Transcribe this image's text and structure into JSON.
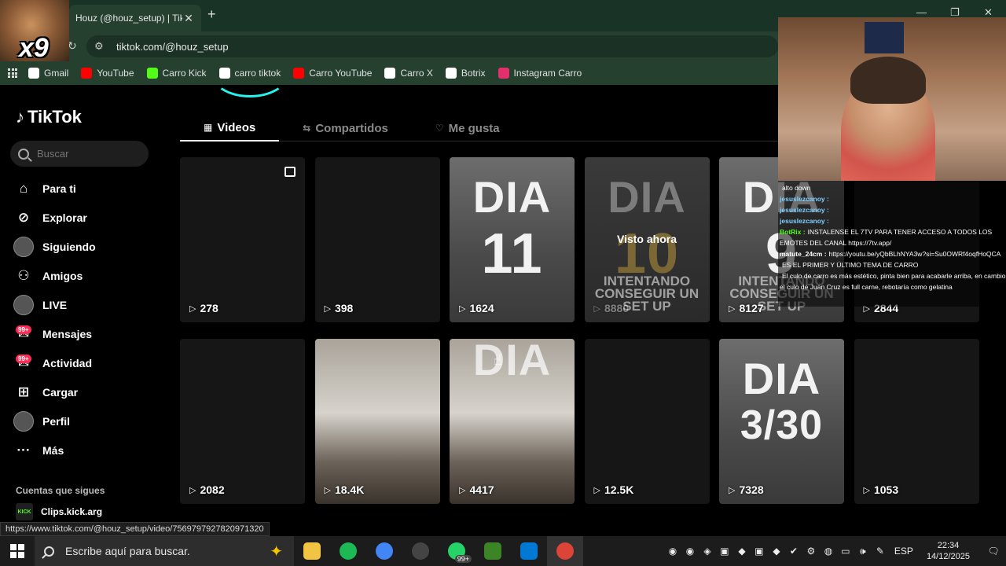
{
  "browser": {
    "tab_title": "Houz (@houz_setup) | TikTok",
    "url": "tiktok.com/@houz_setup",
    "bookmarks": [
      {
        "label": "Gmail",
        "color": "#ffffff"
      },
      {
        "label": "YouTube",
        "color": "#ff0000"
      },
      {
        "label": "Carro Kick",
        "color": "#53fc18"
      },
      {
        "label": "carro tiktok",
        "color": "#ffffff"
      },
      {
        "label": "Carro YouTube",
        "color": "#ff0000"
      },
      {
        "label": "Carro X",
        "color": "#ffffff"
      },
      {
        "label": "Botrix",
        "color": "#ffffff"
      },
      {
        "label": "Instagram Carro",
        "color": "#e1306c"
      }
    ]
  },
  "overlay": {
    "meme_text": "x9"
  },
  "tiktok": {
    "logo": "TikTok",
    "search_placeholder": "Buscar",
    "nav": [
      {
        "label": "Para ti",
        "icon": "home-icon",
        "badge": ""
      },
      {
        "label": "Explorar",
        "icon": "compass-icon",
        "badge": ""
      },
      {
        "label": "Siguiendo",
        "icon": "following-avatar-icon",
        "badge": ""
      },
      {
        "label": "Amigos",
        "icon": "friends-icon",
        "badge": ""
      },
      {
        "label": "LIVE",
        "icon": "live-avatar-icon",
        "badge": ""
      },
      {
        "label": "Mensajes",
        "icon": "messages-icon",
        "badge": "99+"
      },
      {
        "label": "Actividad",
        "icon": "activity-icon",
        "badge": "99+"
      },
      {
        "label": "Cargar",
        "icon": "upload-icon",
        "badge": ""
      },
      {
        "label": "Perfil",
        "icon": "profile-avatar-icon",
        "badge": ""
      },
      {
        "label": "Más",
        "icon": "more-icon",
        "badge": ""
      }
    ],
    "following_header": "Cuentas que sigues",
    "following": [
      {
        "label": "Clips.kick.arg",
        "avatar_text": "KICK"
      }
    ],
    "tabs": [
      {
        "label": "Videos",
        "icon": "grid-icon",
        "active": true
      },
      {
        "label": "Compartidos",
        "icon": "repost-icon",
        "active": false
      },
      {
        "label": "Me gusta",
        "icon": "heart-icon",
        "active": false
      }
    ],
    "videos": [
      {
        "views": "278",
        "style": "plain",
        "big": "",
        "sub": "",
        "watched": "",
        "corner": true
      },
      {
        "views": "398",
        "style": "plain",
        "big": "",
        "sub": "",
        "watched": "",
        "corner": false
      },
      {
        "views": "1624",
        "style": "dia",
        "big": "DIA",
        "num": "11",
        "sub": "",
        "watched": "",
        "corner": false
      },
      {
        "views": "8880",
        "style": "dim",
        "big": "DIA",
        "num": "10",
        "sub": "INTENTANDO CONSEGUIR UN SET UP",
        "watched": "Visto ahora",
        "corner": false
      },
      {
        "views": "8127",
        "style": "dia",
        "big": "DIA",
        "num": "9",
        "sub": "INTENTANDO CONSEGUIR UN SET UP",
        "watched": "",
        "corner": false
      },
      {
        "views": "2844",
        "style": "plain",
        "big": "",
        "sub": "",
        "watched": "",
        "corner": false
      },
      {
        "views": "2082",
        "style": "plain",
        "big": "",
        "sub": "",
        "watched": "",
        "corner": false
      },
      {
        "views": "18.4K",
        "style": "table",
        "big": "",
        "sub": "",
        "watched": "",
        "corner": false
      },
      {
        "views": "4417",
        "style": "table",
        "big": "DIA",
        "sub": "",
        "watched": "",
        "corner": false
      },
      {
        "views": "12.5K",
        "style": "plain",
        "big": "",
        "sub": "",
        "watched": "",
        "corner": false
      },
      {
        "views": "7328",
        "style": "dia",
        "big": "DIA",
        "num": "3/30",
        "sub": "",
        "watched": "",
        "corner": false
      },
      {
        "views": "1053",
        "style": "plain",
        "big": "",
        "sub": "",
        "watched": "",
        "corner": false
      }
    ]
  },
  "chat": [
    {
      "user": "",
      "text": "alto down",
      "color": "#ff9a3c"
    },
    {
      "user": "jesuslezcanoy :",
      "text": "",
      "color": "#7fd0ff"
    },
    {
      "user": "jesuslezcanoy :",
      "text": "",
      "color": "#7fd0ff"
    },
    {
      "user": "jesuslezcanoy :",
      "text": "",
      "color": "#7fd0ff"
    },
    {
      "user": "BotRix :",
      "text": "INSTALENSE EL 7TV PARA TENER ACCESO A TODOS LOS EMOTES DEL CANAL https://7tv.app/",
      "color": "#53fc18"
    },
    {
      "user": "matute_24cm :",
      "text": "https://youtu.be/yQbBLhNYA3w?si=Su0OWRf4oqfHoQCA",
      "color": "#ffffff"
    },
    {
      "user": "",
      "text": "ES EL PRIMER Y ÚLTIMO TEMA DE CARRO",
      "color": "#ff4b4b"
    },
    {
      "user": "",
      "text": "El culo de carro es más estético, pinta bien para acabarle arriba, en cambio el culo de Juan Cruz es full carne, rebotaría como gelatina",
      "color": "#ff9a3c"
    }
  ],
  "status_url": "https://www.tiktok.com/@houz_setup/video/7569797927820971320",
  "taskbar": {
    "search_placeholder": "Escribe aquí para buscar.",
    "apps": [
      {
        "name": "file-explorer-icon",
        "color": "#f2c443",
        "text": "",
        "badge": ""
      },
      {
        "name": "spotify-icon",
        "color": "#1db954",
        "text": "",
        "badge": ""
      },
      {
        "name": "chrome-icon",
        "color": "#4285f4",
        "text": "",
        "badge": ""
      },
      {
        "name": "obs-icon",
        "color": "#444444",
        "text": "",
        "badge": ""
      },
      {
        "name": "whatsapp-icon",
        "color": "#25d366",
        "text": "",
        "badge": "99+"
      },
      {
        "name": "minecraft-icon",
        "color": "#3c8527",
        "text": "",
        "badge": ""
      },
      {
        "name": "store-icon",
        "color": "#0078d4",
        "text": "",
        "badge": ""
      },
      {
        "name": "chrome-active-icon",
        "color": "#db4437",
        "text": "",
        "badge": ""
      }
    ],
    "language": "ESP",
    "time": "22:34",
    "date": "14/12/2025"
  }
}
